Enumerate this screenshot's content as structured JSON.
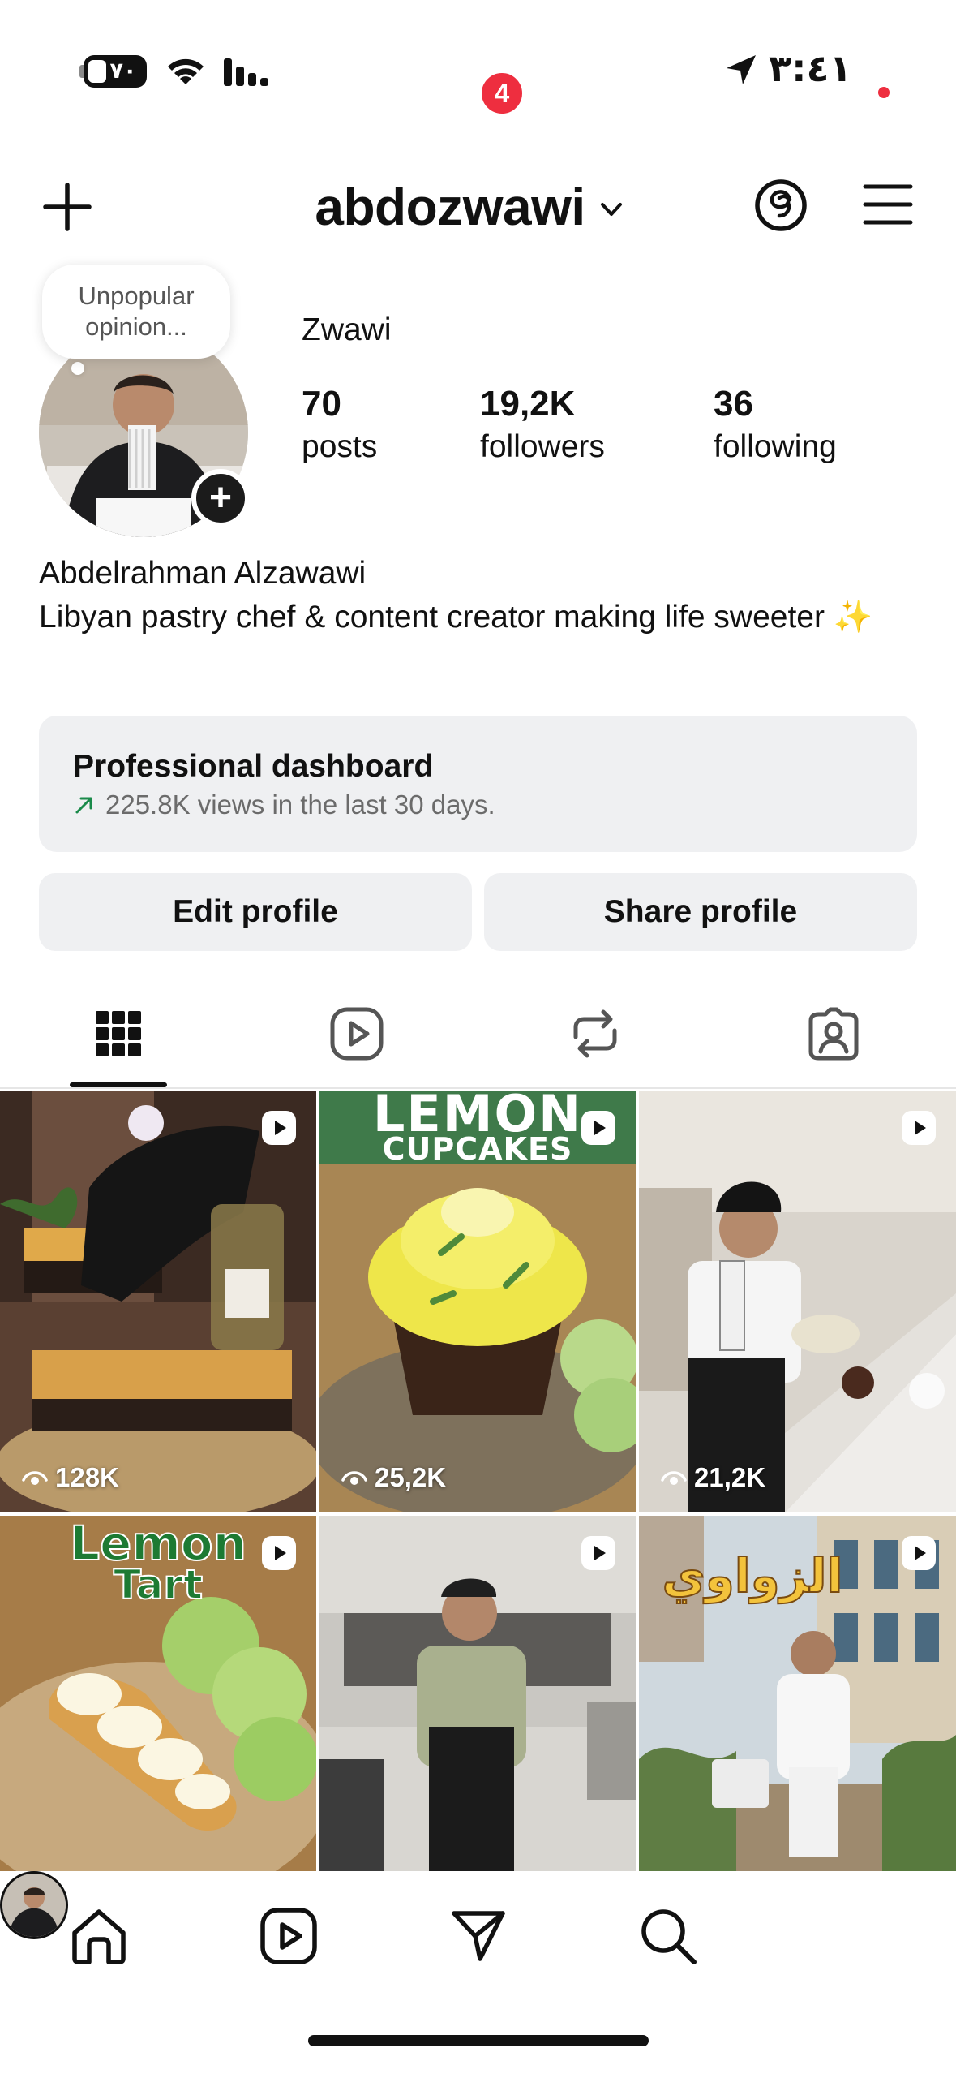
{
  "status_bar": {
    "time": "٣:٤١",
    "battery": "٧٠"
  },
  "header": {
    "username": "abdozwawi"
  },
  "profile": {
    "note": "Unpopular opinion...",
    "display_name": "Zwawi",
    "stats": [
      {
        "value": "70",
        "label": "posts"
      },
      {
        "value": "19,2K",
        "label": "followers"
      },
      {
        "value": "36",
        "label": "following"
      }
    ],
    "bio_name": "Abdelrahman Alzawawi",
    "bio_text": "Libyan pastry chef & content creator making life sweeter",
    "bio_emoji": "✨"
  },
  "dashboard": {
    "title": "Professional dashboard",
    "subtitle": "225.8K views in the last 30 days."
  },
  "buttons": {
    "edit": "Edit profile",
    "share": "Share profile"
  },
  "tabs": {
    "active": "grid",
    "items": [
      "grid-icon",
      "reels-icon",
      "reposts-icon",
      "tagged-icon"
    ]
  },
  "posts": [
    {
      "views": "128K",
      "overlay": ""
    },
    {
      "views": "25,2K",
      "overlay_top": "LEMON",
      "overlay_bottom": "CUPCAKES"
    },
    {
      "views": "21,2K",
      "overlay": ""
    },
    {
      "views": "",
      "overlay_top": "Lemon",
      "overlay_bottom": "Tart"
    },
    {
      "views": "",
      "overlay": ""
    },
    {
      "views": "",
      "overlay": "الزواوي"
    }
  ],
  "bottom_nav": {
    "dm_badge": "4",
    "items": [
      "home-icon",
      "reels-icon",
      "messages-icon",
      "search-icon",
      "profile-avatar"
    ]
  },
  "colors": {
    "accent_red": "#ee2e3f",
    "surface": "#eff0f2",
    "text_primary": "#111111",
    "text_secondary": "#6b6b6b",
    "trend_green": "#1a8a4a"
  }
}
